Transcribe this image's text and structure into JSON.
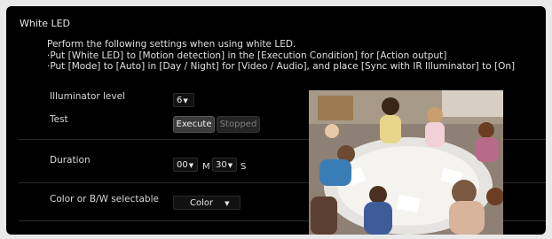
{
  "section": {
    "title": "White LED"
  },
  "description": {
    "line1": "Perform the following settings when using white LED.",
    "line2": "·Put [White LED] to [Motion detection] in the [Execution Condition] for [Action output]",
    "line3": "·Put [Mode] to [Auto] in [Day / Night] for [Video / Audio], and place [Sync with IR Illuminator] to [On]"
  },
  "illuminator": {
    "label": "Illuminator level",
    "value": "6"
  },
  "test": {
    "label": "Test",
    "execute_label": "Execute",
    "status_label": "Stopped"
  },
  "duration": {
    "label": "Duration",
    "minutes": "00",
    "minutes_unit": "M",
    "seconds": "30",
    "seconds_unit": "S"
  },
  "color_mode": {
    "label": "Color or B/W selectable",
    "value": "Color"
  },
  "icons": {
    "dropdown": "triangle-down-icon"
  },
  "colors": {
    "background": "#000000",
    "text": "#e0e0e0",
    "divider": "#2b2b2b"
  }
}
